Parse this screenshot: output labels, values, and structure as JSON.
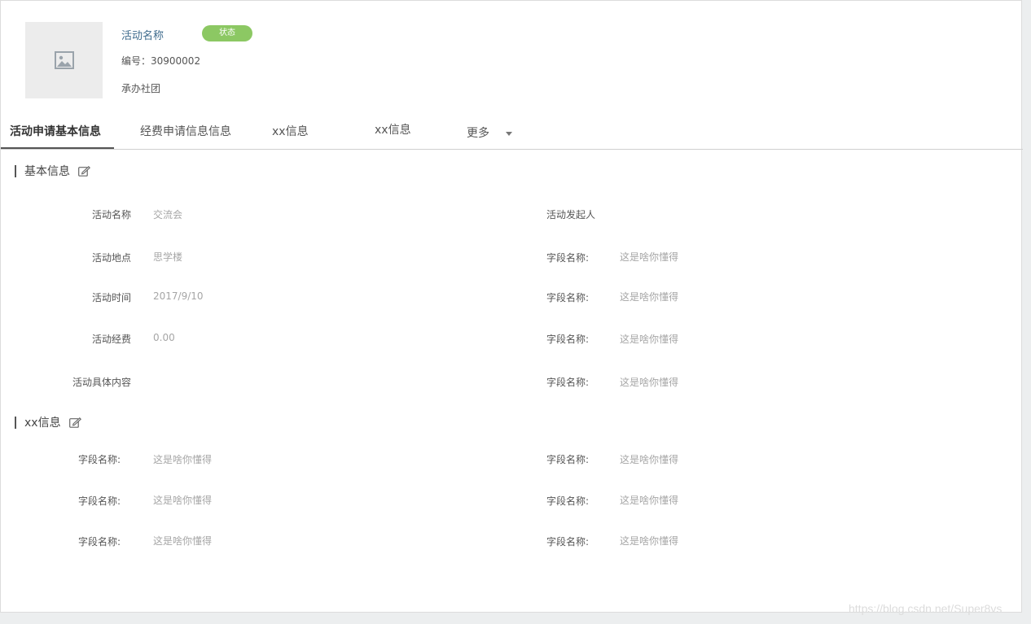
{
  "header": {
    "activity_name": "活动名称",
    "status_badge": "状态",
    "code_line": "编号：30900002",
    "organizer": "承办社团",
    "thumbnail_icon": "image-placeholder-icon"
  },
  "tabs": [
    {
      "label": "活动申请基本信息",
      "active": true
    },
    {
      "label": "经费申请信息信息"
    },
    {
      "label": "xx信息"
    },
    {
      "label": "xx信息"
    },
    {
      "label": "更多"
    }
  ],
  "section_basic": {
    "title": "基本信息",
    "left_fields": [
      {
        "label": "活动名称",
        "value": "交流会"
      },
      {
        "label": "活动地点",
        "value": "思学楼"
      },
      {
        "label": "活动时间",
        "value": "2017/9/10"
      },
      {
        "label": "活动经费",
        "value": "0.00"
      },
      {
        "label": "活动具体内容",
        "value": ""
      }
    ],
    "right_fields": [
      {
        "label": "活动发起人",
        "value": ""
      },
      {
        "label": "字段名称:",
        "value": "这是啥你懂得"
      },
      {
        "label": "字段名称:",
        "value": "这是啥你懂得"
      },
      {
        "label": "字段名称:",
        "value": "这是啥你懂得"
      },
      {
        "label": "字段名称:",
        "value": "这是啥你懂得"
      }
    ]
  },
  "section_xx": {
    "title": "xx信息",
    "left_fields": [
      {
        "label": "字段名称:",
        "value": "这是啥你懂得"
      },
      {
        "label": "字段名称:",
        "value": "这是啥你懂得"
      },
      {
        "label": "字段名称:",
        "value": "这是啥你懂得"
      }
    ],
    "right_fields": [
      {
        "label": "字段名称:",
        "value": "这是啥你懂得"
      },
      {
        "label": "字段名称:",
        "value": "这是啥你懂得"
      },
      {
        "label": "字段名称:",
        "value": "这是啥你懂得"
      }
    ]
  },
  "watermark": "https://blog.csdn.net/Super8vs",
  "colors": {
    "badge": "#8cc863",
    "activity_name": "#3d6a8c"
  }
}
